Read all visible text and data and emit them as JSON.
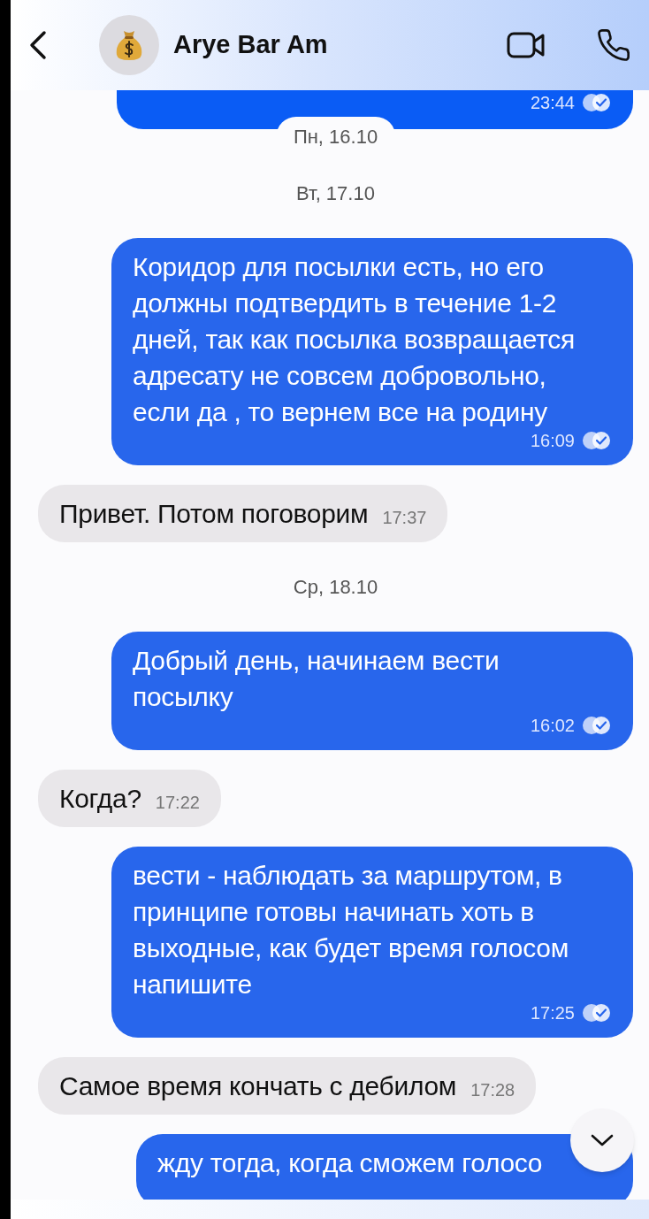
{
  "header": {
    "contact_name": "Arye Bar Am"
  },
  "messages": [
    {
      "kind": "out",
      "partial": true,
      "time": "23:44"
    },
    {
      "kind": "date",
      "text": "Пн, 16.10",
      "floating": true
    },
    {
      "kind": "date",
      "text": "Вт, 17.10"
    },
    {
      "kind": "out",
      "text": "Коридор для посылки есть, но его должны подтвердить в течение 1-2 дней, так как посылка возвращается адресату не совсем добровольно, если да , то вернем все на родину",
      "time": "16:09"
    },
    {
      "kind": "in",
      "text": "Привет. Потом поговорим",
      "time": "17:37"
    },
    {
      "kind": "date",
      "text": "Ср, 18.10"
    },
    {
      "kind": "out",
      "text": "Добрый день, начинаем вести посылку",
      "time": "16:02"
    },
    {
      "kind": "in",
      "text": "Когда?",
      "time": "17:22"
    },
    {
      "kind": "out",
      "text": "вести - наблюдать за маршрутом, в принципе готовы начинать хоть в выходные, как будет время голосом напишите",
      "time": "17:25"
    },
    {
      "kind": "in",
      "text": "Самое время кончать с дебилом",
      "time": "17:28"
    },
    {
      "kind": "out",
      "cut": true,
      "text": "жду тогда, когда сможем голосо"
    }
  ]
}
